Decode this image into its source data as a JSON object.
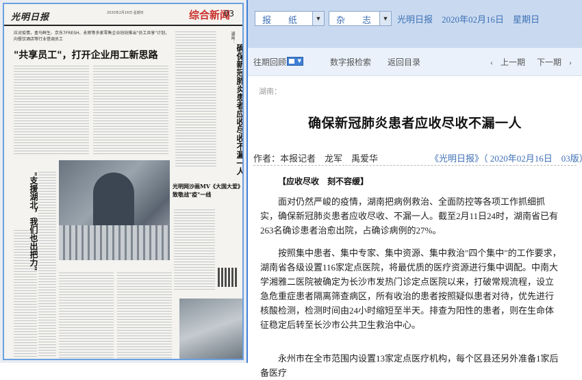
{
  "paper": {
    "logo": "光明日报",
    "date": "2020年2月16日 星期日",
    "section": "综合新闻",
    "page": "03",
    "deck": "应对疫情，盒马鲜生、京东7FRESH、永辉等多家零售企业纷纷推出\"员工共享\"计划，向餐饮酒店等行业借调员工",
    "headline": "\"共享员工\"，打开企业用工新思路",
    "right_label": "湖南：",
    "right_title": "确保新冠肺炎患者应收尽收不漏一人",
    "left_title": "\"支援湖北，我们也出把力\"",
    "mv_title": "光明网沙画MV《大国大爱》致敬战\"疫\"一线"
  },
  "top": {
    "select_paper": "报　纸",
    "select_magazine": "杂　志",
    "title": "光明日报　2020年02月16日　星期日"
  },
  "nav": {
    "history": "往期回顾",
    "search": "数字报检索",
    "back": "返回目录",
    "prev": "上一期",
    "next": "下一期",
    "prev_icon": "chevron-left",
    "next_icon": "chevron-right"
  },
  "article": {
    "location": "湖南：",
    "title": "确保新冠肺炎患者应收尽收不漏一人",
    "byline": "作者：本报记者　龙军　禹爱华",
    "source": "《光明日报》（ 2020年02月16日　03版）",
    "subhead": "【应收尽收　刻不容缓】",
    "paragraphs": [
      "面对仍然严峻的疫情，湖南把病例救治、全面防控等各项工作抓细抓实，确保新冠肺炎患者应收尽收、不漏一人。截至2月11日24时，湖南省已有263名确诊患者治愈出院，占确诊病例的27%。",
      "按照集中患者、集中专家、集中资源、集中救治\"四个集中\"的工作要求，湖南省各级设置116家定点医院，将最优质的医疗资源进行集中调配。中南大学湘雅二医院被确定为长沙市发热门诊定点医院以来，打破常规流程，设立急危重症患者隔离筛查病区，所有收治的患者按照疑似患者对待，优先进行核酸检测，检测时间由24小时缩短至半天。排查为阳性的患者，则在生命体征稳定后转至长沙市公共卫生救治中心。",
      "永州市在全市范围内设置13家定点医疗机构，每个区县还另外准备1家后备医疗"
    ]
  }
}
